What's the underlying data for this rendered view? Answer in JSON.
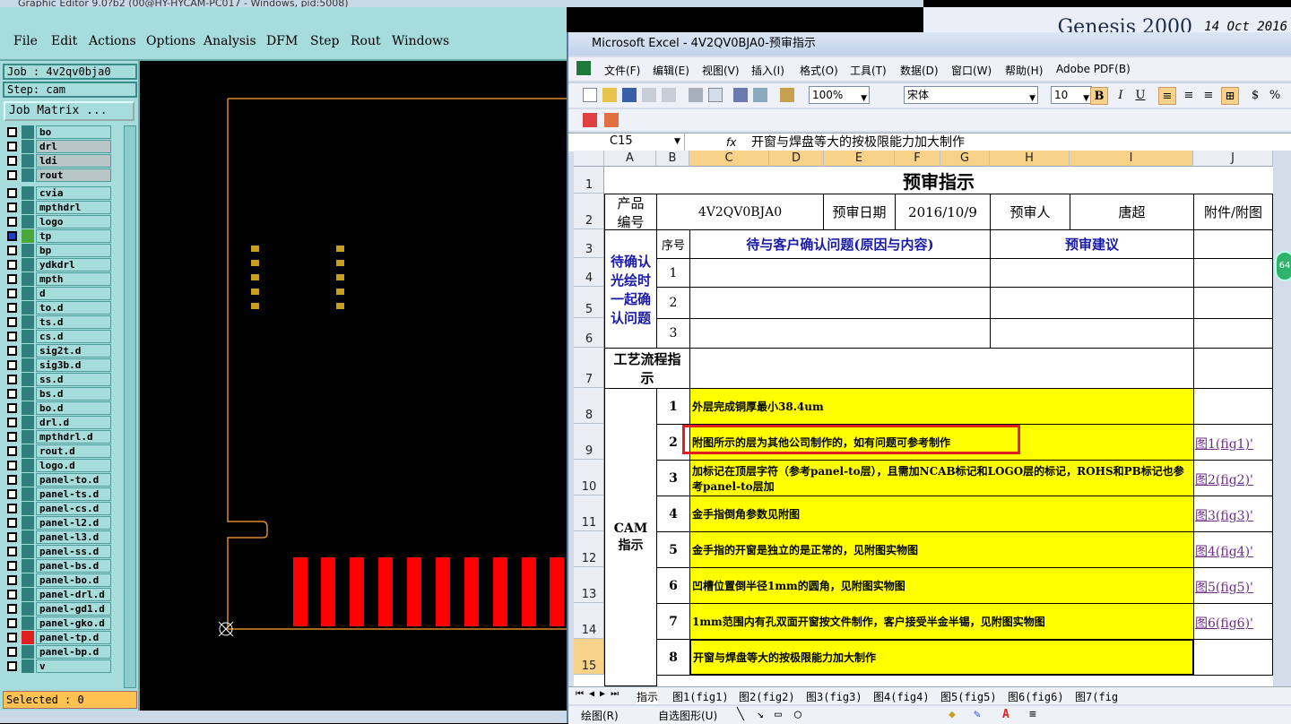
{
  "genesis": {
    "window_title": "Graphic Editor 9.0?b2 (00@HY-HYCAM-PC017 - Windows, pid:5008)",
    "menu": [
      "File",
      "Edit",
      "Actions",
      "Options",
      "Analysis",
      "DFM",
      "Step",
      "Rout",
      "Windows"
    ],
    "job_label": "Job : 4v2qv0bja0",
    "step_label": "Step: cam",
    "job_matrix_label": "Job Matrix ...",
    "selected_label": "Selected : 0",
    "product_title": "Genesis 2000",
    "product_date": "14 Oct 2016",
    "layers": [
      {
        "name": "bo",
        "color": "#2f7f7f"
      },
      {
        "name": "drl",
        "color": "#2f7f7f",
        "grey": true
      },
      {
        "name": "ldi",
        "color": "#2f7f7f",
        "grey": true
      },
      {
        "name": "rout",
        "color": "#2f7f7f",
        "grey": true
      },
      {
        "name": "cvia",
        "color": "#2f7f7f"
      },
      {
        "name": "mpthdrl",
        "color": "#2f7f7f"
      },
      {
        "name": "logo",
        "color": "#2f7f7f"
      },
      {
        "name": "tp",
        "color": "#4aa83a",
        "active": true
      },
      {
        "name": "bp",
        "color": "#2f7f7f"
      },
      {
        "name": "ydkdrl",
        "color": "#2f7f7f"
      },
      {
        "name": "mpth",
        "color": "#2f7f7f"
      },
      {
        "name": "d",
        "color": "#2f7f7f"
      },
      {
        "name": "to.d",
        "color": "#2f7f7f"
      },
      {
        "name": "ts.d",
        "color": "#2f7f7f"
      },
      {
        "name": "cs.d",
        "color": "#2f7f7f"
      },
      {
        "name": "sig2t.d",
        "color": "#2f7f7f"
      },
      {
        "name": "sig3b.d",
        "color": "#2f7f7f"
      },
      {
        "name": "ss.d",
        "color": "#2f7f7f"
      },
      {
        "name": "bs.d",
        "color": "#2f7f7f"
      },
      {
        "name": "bo.d",
        "color": "#2f7f7f"
      },
      {
        "name": "drl.d",
        "color": "#2f7f7f"
      },
      {
        "name": "mpthdrl.d",
        "color": "#2f7f7f"
      },
      {
        "name": "rout.d",
        "color": "#2f7f7f"
      },
      {
        "name": "logo.d",
        "color": "#2f7f7f"
      },
      {
        "name": "panel-to.d",
        "color": "#2f7f7f"
      },
      {
        "name": "panel-ts.d",
        "color": "#2f7f7f"
      },
      {
        "name": "panel-cs.d",
        "color": "#2f7f7f"
      },
      {
        "name": "panel-l2.d",
        "color": "#2f7f7f"
      },
      {
        "name": "panel-l3.d",
        "color": "#2f7f7f"
      },
      {
        "name": "panel-ss.d",
        "color": "#2f7f7f"
      },
      {
        "name": "panel-bs.d",
        "color": "#2f7f7f"
      },
      {
        "name": "panel-bo.d",
        "color": "#2f7f7f"
      },
      {
        "name": "panel-drl.d",
        "color": "#2f7f7f"
      },
      {
        "name": "panel-gd1.d",
        "color": "#2f7f7f"
      },
      {
        "name": "panel-gko.d",
        "color": "#2f7f7f"
      },
      {
        "name": "panel-tp.d",
        "color": "#e02020"
      },
      {
        "name": "panel-bp.d",
        "color": "#2f7f7f"
      },
      {
        "name": "v",
        "color": "#2f7f7f"
      }
    ]
  },
  "excel": {
    "title": "Microsoft Excel - 4V2QV0BJA0-预审指示",
    "menu": [
      "文件(F)",
      "编辑(E)",
      "视图(V)",
      "插入(I)",
      "格式(O)",
      "工具(T)",
      "数据(D)",
      "窗口(W)",
      "帮助(H)",
      "Adobe PDF(B)"
    ],
    "zoom": "100%",
    "font_name": "宋体",
    "font_size": "10",
    "name_box": "C15",
    "fx": "fx",
    "formula": "开窗与焊盘等大的按极限能力加大制作",
    "columns": [
      "A",
      "B",
      "C",
      "D",
      "E",
      "F",
      "G",
      "H",
      "I",
      "J"
    ],
    "rows": [
      "1",
      "2",
      "3",
      "4",
      "5",
      "6",
      "7",
      "8",
      "9",
      "10",
      "11",
      "12",
      "13",
      "14",
      "15"
    ],
    "sheet_title": "预审指示",
    "product_label": "产品编号",
    "product_no": "4V2QV0BJA0",
    "review_date_label": "预审日期",
    "review_date": "2016/10/9",
    "reviewer_label": "预审人",
    "reviewer": "唐超",
    "attach_label": "附件/附图",
    "seq_label": "序号",
    "issue_header": "待与客户确认问题(原因与内容)",
    "suggest_header": "预审建议",
    "pending_label": "待确认光绘时一起确认问题",
    "pending_rows": [
      "1",
      "2",
      "3"
    ],
    "process_label": "工艺流程指示",
    "cam_label": "CAM指示",
    "cam_rows": [
      {
        "no": "1",
        "text": "外层完成铜厚最小38.4um",
        "link": ""
      },
      {
        "no": "2",
        "text": "附图所示的层为其他公司制作的，如有问题可参考制作",
        "link": "图1(fig1)'"
      },
      {
        "no": "3",
        "text": "加标记在顶层字符（参考panel-to层），且需加NCAB标记和LOGO层的标记，ROHS和PB标记也参考panel-to层加",
        "link": "图2(fig2)'"
      },
      {
        "no": "4",
        "text": "金手指倒角参数见附图",
        "link": "图3(fig3)'"
      },
      {
        "no": "5",
        "text": "金手指的开窗是独立的是正常的，见附图实物图",
        "link": "图4(fig4)'"
      },
      {
        "no": "6",
        "text": "凹槽位置倒半径1mm的圆角，见附图实物图",
        "link": "图5(fig5)'"
      },
      {
        "no": "7",
        "text": "1mm范围内有孔双面开窗按文件制作，客户接受半金半锡，见附图实物图",
        "link": "图6(fig6)'"
      },
      {
        "no": "8",
        "text": "开窗与焊盘等大的按极限能力加大制作",
        "link": ""
      }
    ],
    "tabs": [
      "指示",
      "图1(fig1)",
      "图2(fig2)",
      "图3(fig3)",
      "图4(fig4)",
      "图5(fig5)",
      "图6(fig6)",
      "图7(fig"
    ],
    "draw_label": "绘图(R)",
    "autoshape_label": "自选图形(U)",
    "badge": "64"
  }
}
